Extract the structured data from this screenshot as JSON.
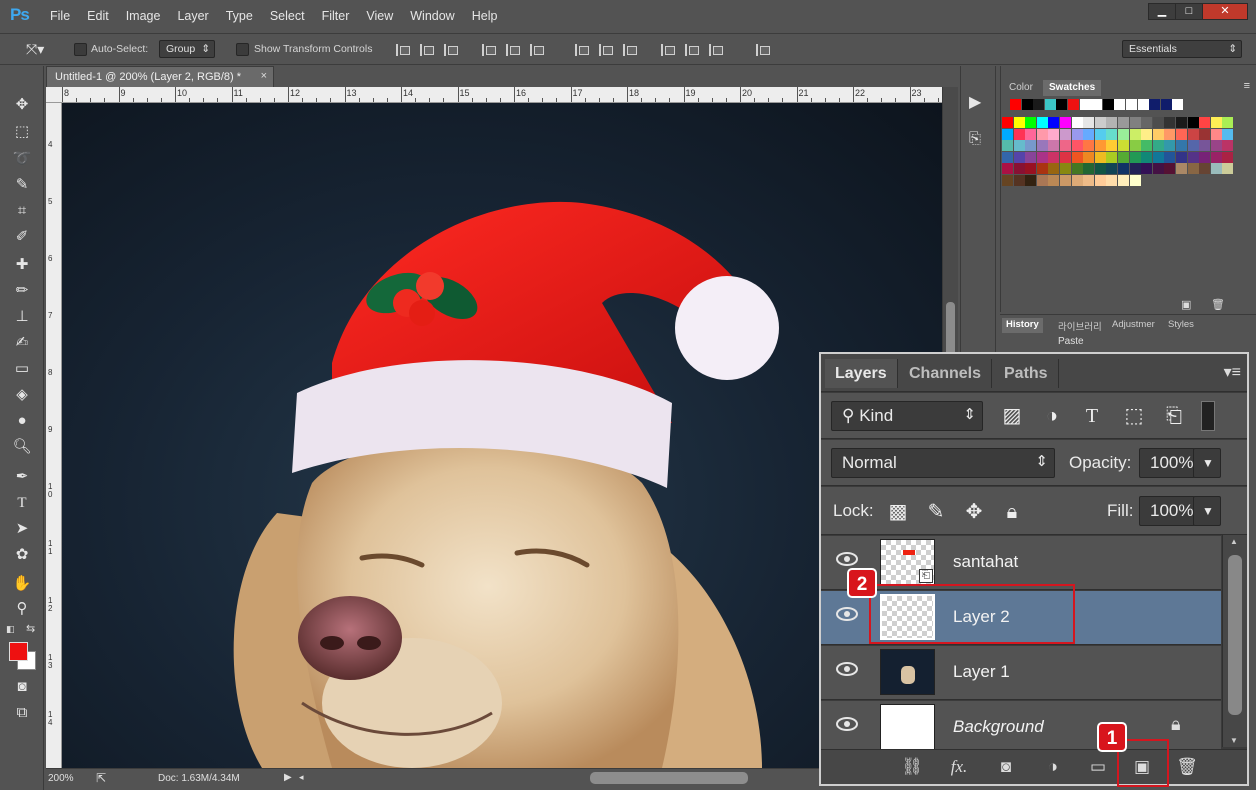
{
  "app": {
    "logo": "Ps"
  },
  "menu": [
    "File",
    "Edit",
    "Image",
    "Layer",
    "Type",
    "Select",
    "Filter",
    "View",
    "Window",
    "Help"
  ],
  "window_controls": {
    "minimize": "▁",
    "maximize": "□",
    "close": "✕"
  },
  "options": {
    "auto_select_label": "Auto-Select:",
    "auto_select_value": "Group",
    "transform_label": "Show Transform Controls",
    "workspace": "Essentials"
  },
  "document": {
    "tab_title": "Untitled-1 @ 200% (Layer 2, RGB/8) *",
    "close": "×",
    "ruler_h": [
      "8",
      "9",
      "10",
      "11",
      "12",
      "13",
      "14",
      "15",
      "16",
      "17",
      "18",
      "19",
      "20",
      "21",
      "22",
      "23"
    ],
    "ruler_v": [
      "4",
      "5",
      "6",
      "7",
      "8",
      "9",
      "1 0",
      "1 1",
      "1 2",
      "1 3",
      "1 4"
    ]
  },
  "status": {
    "zoom": "200%",
    "doc_info": "Doc: 1.63M/4.34M"
  },
  "panels": {
    "color_tab": "Color",
    "swatches_tab": "Swatches",
    "history_tabs": [
      "History",
      "라이브러리",
      "Adjustmer",
      "Styles"
    ],
    "history_item": "Paste"
  },
  "swatch_colors": {
    "row0": [
      "#ff0000",
      "#000000",
      "#1a1a1a",
      "#3cc6c6",
      "#000000",
      "#ee1111",
      "#ffffff",
      "#ffffff",
      "#000000",
      "#ffffff",
      "#ffffff",
      "#ffffff",
      "#101d6b",
      "#101d6b",
      "#ffffff"
    ],
    "rows": [
      [
        "#ff0000",
        "#ffff00",
        "#00ff00",
        "#00ffff",
        "#0000ff",
        "#ff00ff",
        "#ffffff",
        "#e6e6e6",
        "#cccccc",
        "#b3b3b3",
        "#999999",
        "#808080",
        "#666666",
        "#4d4d4d",
        "#333333",
        "#1a1a1a",
        "#000000",
        "#ff4444",
        "#ffee55",
        "#aaee55"
      ],
      [
        "#00aaff",
        "#ff3355",
        "#ff6699",
        "#ff99aa",
        "#ffaacc",
        "#cc99cc",
        "#9999ee",
        "#66aaff",
        "#55ccee",
        "#66ddcc",
        "#99ee99",
        "#ccee66",
        "#ffee88",
        "#ffcc66",
        "#ff9966",
        "#ff6655",
        "#cc4444",
        "#993333",
        "#ff8888",
        "#55bbee"
      ],
      [
        "#55bbaa",
        "#66bbcc",
        "#7799cc",
        "#9977bb",
        "#cc77aa",
        "#ee6688",
        "#ff5566",
        "#ff7744",
        "#ff9933",
        "#ffcc33",
        "#ccdd33",
        "#88cc44",
        "#44bb66",
        "#33aa88",
        "#3399aa",
        "#3377aa",
        "#5566aa",
        "#775599",
        "#994488",
        "#bb3366"
      ],
      [
        "#3366aa",
        "#5544aa",
        "#884499",
        "#aa3388",
        "#cc3366",
        "#dd3344",
        "#ee5522",
        "#ee8822",
        "#eebb22",
        "#aacc22",
        "#55aa33",
        "#229955",
        "#118877",
        "#117799",
        "#225599",
        "#333388",
        "#553388",
        "#772277",
        "#992266",
        "#aa2244"
      ],
      [
        "#aa1144",
        "#881133",
        "#991122",
        "#aa3311",
        "#996611",
        "#888811",
        "#447722",
        "#226633",
        "#115544",
        "#114455",
        "#113366",
        "#222255",
        "#331155",
        "#441144",
        "#551133",
        "#aa8866",
        "#886644",
        "#664433",
        "#99bbbb",
        "#cccc99"
      ],
      [
        "#664422",
        "#553322",
        "#332211",
        "#aa7755",
        "#bb8855",
        "#cc9966",
        "#ddaa77",
        "#eebb88",
        "#ffcc99",
        "#ffddaa",
        "#ffeebb",
        "#ffffcc"
      ]
    ]
  },
  "layers_panel": {
    "tabs": [
      "Layers",
      "Channels",
      "Paths"
    ],
    "filter_kind": "Kind",
    "blend_mode": "Normal",
    "opacity_label": "Opacity:",
    "opacity_value": "100%",
    "lock_label": "Lock:",
    "fill_label": "Fill:",
    "fill_value": "100%",
    "layers": [
      {
        "name": "santahat",
        "selected": false
      },
      {
        "name": "Layer 2",
        "selected": true
      },
      {
        "name": "Layer 1",
        "selected": false
      },
      {
        "name": "Background",
        "selected": false,
        "locked": true
      }
    ],
    "footer_icons": [
      "link-icon",
      "fx-icon",
      "mask-icon",
      "adjustment-icon",
      "folder-icon",
      "new-layer-icon",
      "trash-icon"
    ],
    "fx_label": "fx"
  },
  "callouts": {
    "one": "1",
    "two": "2"
  },
  "colors": {
    "foreground": "#ee1111",
    "background": "#ffffff",
    "selection": "#5e7896",
    "callout": "#d8151c"
  }
}
